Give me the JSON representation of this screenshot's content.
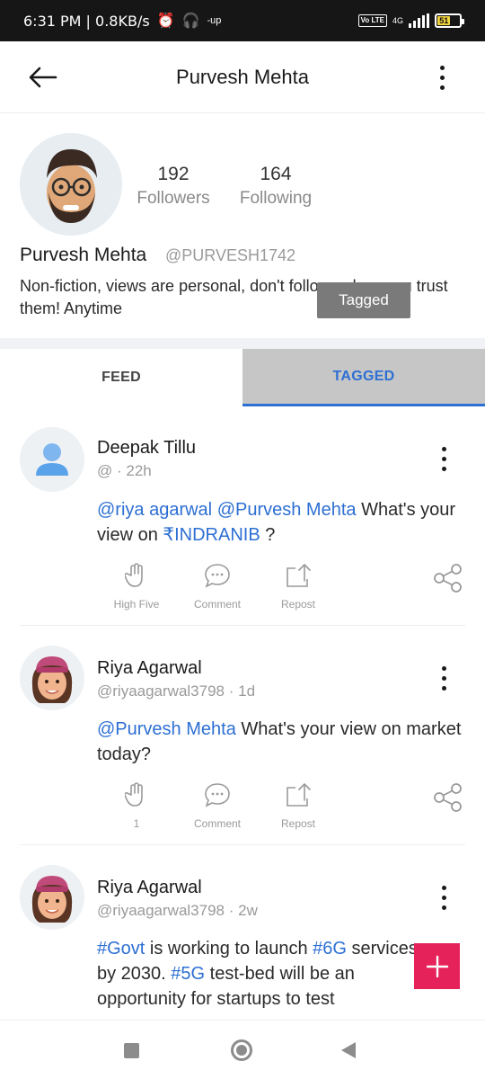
{
  "status_bar": {
    "text": "6:31 PM | 0.8KB/s",
    "icons": [
      "alarm-icon",
      "headset-icon",
      "up-icon",
      "volte-icon",
      "signal-icon",
      "battery-icon"
    ],
    "up_label": "-up",
    "volte_label": "Vo LTE",
    "network_label": "4G",
    "battery_level": "51"
  },
  "app_bar": {
    "title": "Purvesh Mehta",
    "back_icon": "arrow-left-icon",
    "menu_icon": "more-vertical-icon"
  },
  "profile": {
    "name": "Purvesh Mehta",
    "handle": "@PURVESH1742",
    "followers_count": "192",
    "followers_label": "Followers",
    "following_count": "164",
    "following_label": "Following",
    "bio": "Non-fiction, views are personal, don't follow unless you trust them! Anytime"
  },
  "toast": {
    "text": "Tagged"
  },
  "tabs": [
    {
      "label": "FEED",
      "active": false
    },
    {
      "label": "TAGGED",
      "active": true
    }
  ],
  "posts": [
    {
      "author": "Deepak Tillu",
      "handle": "@",
      "time": " · 22h",
      "body_parts": [
        {
          "text": "@riya agarwal",
          "type": "mention"
        },
        {
          "text": " ",
          "type": "text"
        },
        {
          "text": "@Purvesh Mehta",
          "type": "mention"
        },
        {
          "text": "  What's your view on  ",
          "type": "text"
        },
        {
          "text": "₹INDRANIB",
          "type": "mention"
        },
        {
          "text": " ?",
          "type": "text"
        }
      ],
      "actions": [
        "High Five",
        "Comment",
        "Repost"
      ]
    },
    {
      "author": "Riya Agarwal",
      "handle": "@riyaagarwal3798",
      "time": " · 1d",
      "body_parts": [
        {
          "text": "@Purvesh Mehta",
          "type": "mention"
        },
        {
          "text": " What's your view on market today?",
          "type": "text"
        }
      ],
      "actions": [
        "1",
        "Comment",
        "Repost"
      ]
    },
    {
      "author": "Riya Agarwal",
      "handle": "@riyaagarwal3798",
      "time": " · 2w",
      "body_parts": [
        {
          "text": "#Govt",
          "type": "tag"
        },
        {
          "text": " is working to launch ",
          "type": "text"
        },
        {
          "text": "#6G",
          "type": "tag"
        },
        {
          "text": " services by 2030. ",
          "type": "text"
        },
        {
          "text": "#5G",
          "type": "tag"
        },
        {
          "text": " test-bed will be an opportunity for startups to test",
          "type": "text"
        }
      ]
    }
  ],
  "colors": {
    "accent": "#2d6fd3",
    "fab": "#e5225a",
    "status_bar": "#161616",
    "tab_active_bg": "#c6c6c6"
  },
  "fab": {
    "icon": "plus-icon"
  },
  "nav_bar": {
    "icons": [
      "recents-square-icon",
      "home-circle-icon",
      "back-triangle-icon"
    ]
  }
}
